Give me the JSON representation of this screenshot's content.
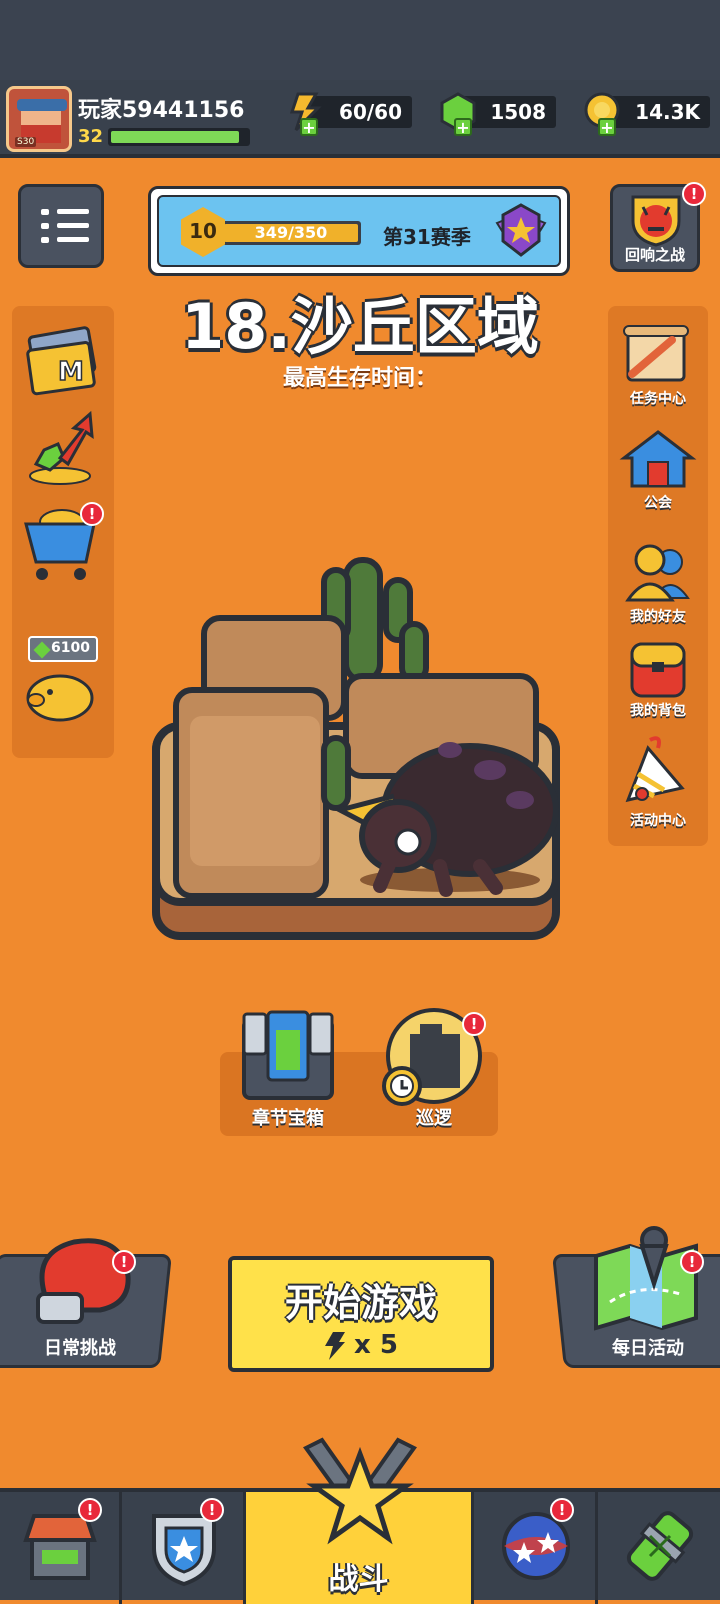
{
  "header": {
    "player_name": "玩家59441156",
    "level": "32",
    "xp_fraction": 0.94,
    "avatar_tag": "S30",
    "energy": "60/60",
    "gems": "1508",
    "gold": "14.3K"
  },
  "season": {
    "level": "10",
    "progress_text": "349/350",
    "progress_fraction": 0.997,
    "label": "第31赛季"
  },
  "echo_battle": {
    "label": "回响之战",
    "badge": "!"
  },
  "map": {
    "title": "18.沙丘区域",
    "survival_label": "最高生存时间："
  },
  "left_menu": {
    "piggy_gems": "6100",
    "cart_badge": "!"
  },
  "right_menu": [
    {
      "label": "任务中心",
      "icon": "scroll-icon"
    },
    {
      "label": "公会",
      "icon": "guild-house-icon"
    },
    {
      "label": "我的好友",
      "icon": "friends-icon"
    },
    {
      "label": "我的背包",
      "icon": "backpack-icon"
    },
    {
      "label": "活动中心",
      "icon": "party-horn-icon"
    }
  ],
  "chapter": {
    "chest_label": "章节宝箱",
    "patrol_label": "巡逻",
    "patrol_badge": "!"
  },
  "actions": {
    "daily_challenge": "日常挑战",
    "daily_event": "每日活动",
    "start_label": "开始游戏",
    "start_cost": "x 5",
    "badge": "!"
  },
  "bottom_nav": {
    "battle_label": "战斗",
    "badge": "!"
  },
  "colors": {
    "background": "#f08a2e",
    "topbar": "#39414d",
    "start_button": "#ffe14a",
    "alert_badge": "#e8283a"
  }
}
